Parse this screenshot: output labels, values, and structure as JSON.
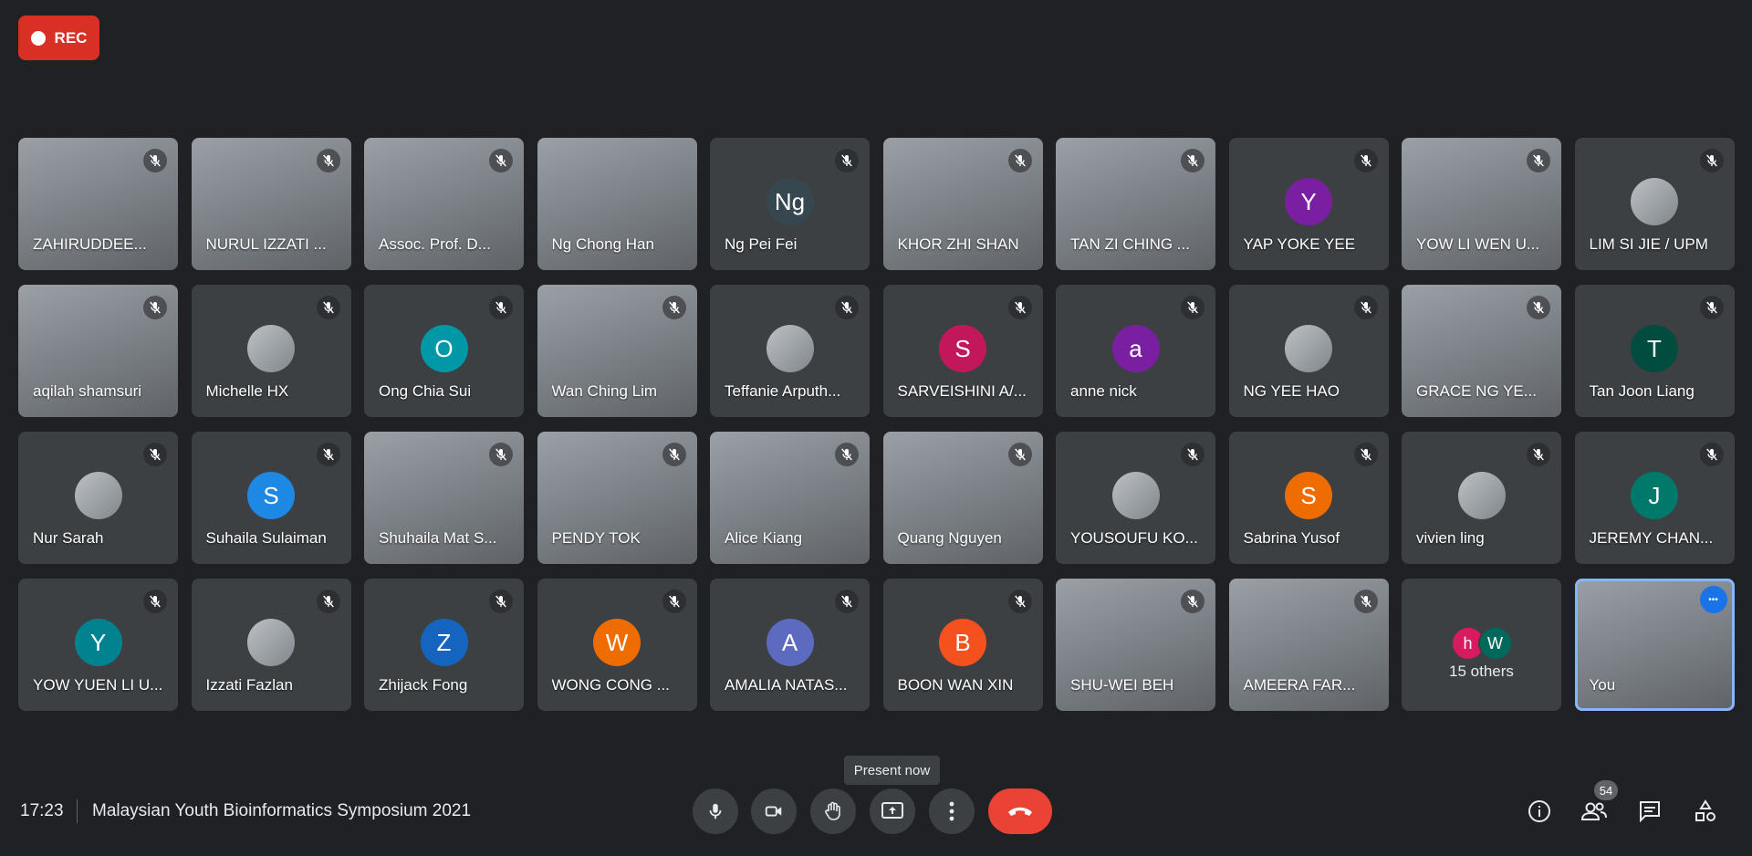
{
  "recording": {
    "label": "REC"
  },
  "participants": [
    {
      "name": "ZAHIRUDDEE...",
      "video": true
    },
    {
      "name": "NURUL IZZATI ...",
      "video": true
    },
    {
      "name": "Assoc. Prof. D...",
      "video": true
    },
    {
      "name": "Ng Chong Han",
      "video": true,
      "unmuted": true
    },
    {
      "name": "Ng Pei Fei",
      "initial": "Ng",
      "color": "#37474f"
    },
    {
      "name": "KHOR ZHI SHAN",
      "video": true
    },
    {
      "name": "TAN ZI CHING ...",
      "video": true
    },
    {
      "name": "YAP YOKE YEE",
      "initial": "Y",
      "color": "#7b1fa2"
    },
    {
      "name": "YOW LI WEN U...",
      "video": true
    },
    {
      "name": "LIM SI JIE / UPM",
      "photo": true
    },
    {
      "name": "aqilah shamsuri",
      "video": true
    },
    {
      "name": "Michelle HX",
      "photo": true
    },
    {
      "name": "Ong Chia Sui",
      "initial": "O",
      "color": "#0097a7"
    },
    {
      "name": "Wan Ching Lim",
      "video": true
    },
    {
      "name": "Teffanie Arputh...",
      "photo": true
    },
    {
      "name": "SARVEISHINI A/...",
      "initial": "S",
      "color": "#c2185b"
    },
    {
      "name": "anne nick",
      "initial": "a",
      "color": "#7b1fa2"
    },
    {
      "name": "NG YEE HAO",
      "photo": true
    },
    {
      "name": "GRACE NG YE...",
      "video": true
    },
    {
      "name": "Tan Joon Liang",
      "initial": "T",
      "color": "#004d40"
    },
    {
      "name": "Nur Sarah",
      "photo": true
    },
    {
      "name": "Suhaila Sulaiman",
      "initial": "S",
      "color": "#1e88e5"
    },
    {
      "name": "Shuhaila Mat S...",
      "video": true
    },
    {
      "name": "PENDY TOK",
      "video": true
    },
    {
      "name": "Alice Kiang",
      "video": true
    },
    {
      "name": "Quang Nguyen",
      "video": true
    },
    {
      "name": "YOUSOUFU KO...",
      "photo": true
    },
    {
      "name": "Sabrina Yusof",
      "initial": "S",
      "color": "#ef6c00"
    },
    {
      "name": "vivien ling",
      "photo": true
    },
    {
      "name": "JEREMY CHAN...",
      "initial": "J",
      "color": "#00796b"
    },
    {
      "name": "YOW YUEN LI U...",
      "initial": "Y",
      "color": "#00838f"
    },
    {
      "name": "Izzati Fazlan",
      "photo": true
    },
    {
      "name": "Zhijack Fong",
      "initial": "Z",
      "color": "#1565c0"
    },
    {
      "name": "WONG CONG ...",
      "initial": "W",
      "color": "#ef6c00"
    },
    {
      "name": "AMALIA NATAS...",
      "initial": "A",
      "color": "#5c6bc0"
    },
    {
      "name": "BOON WAN XIN",
      "initial": "B",
      "color": "#f4511e"
    },
    {
      "name": "SHU-WEI BEH",
      "video": true
    },
    {
      "name": "AMEERA FAR...",
      "video": true
    }
  ],
  "others": {
    "label": "15 others",
    "initials": [
      "h",
      "W"
    ],
    "colors": [
      "#d81b60",
      "#00695c"
    ]
  },
  "self": {
    "name": "You"
  },
  "tooltip": "Present now",
  "bottom": {
    "time": "17:23",
    "meeting_title": "Malaysian Youth Bioinformatics Symposium 2021",
    "participant_count": "54"
  },
  "icons": [
    "mic-icon",
    "camera-icon",
    "raise-hand-icon",
    "present-icon",
    "more-options-icon",
    "end-call-icon",
    "info-icon",
    "people-icon",
    "chat-icon",
    "activities-icon"
  ]
}
